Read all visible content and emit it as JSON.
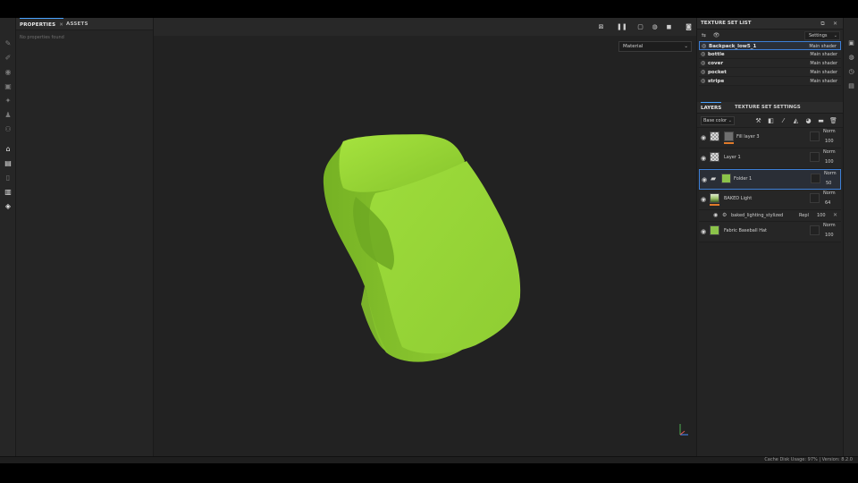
{
  "left_panel": {
    "tabs": [
      {
        "label": "PROPERTIES",
        "selected": true
      },
      {
        "label": "ASSETS",
        "selected": false
      }
    ],
    "empty_message": "No properties found"
  },
  "toolbar": {
    "tools": [
      "paint-brush-icon",
      "eraser-icon",
      "projection-icon",
      "geometry-mask-icon",
      "smudge-icon",
      "clone-icon",
      "material-picker-icon",
      "bake-icon",
      "layers-stack-icon",
      "texture-set-icon",
      "export-icon",
      "shelf-icon"
    ]
  },
  "viewport": {
    "mode_select": "Material",
    "colors": {
      "model": "#a3e040",
      "background": "#222222"
    }
  },
  "texture_set_list": {
    "title": "TEXTURE SET LIST",
    "settings_label": "Settings",
    "sets": [
      {
        "name": "Backpack_low5_1",
        "shader": "Main shader",
        "selected": true
      },
      {
        "name": "bottle",
        "shader": "Main shader",
        "selected": false
      },
      {
        "name": "cover",
        "shader": "Main shader",
        "selected": false
      },
      {
        "name": "pocket",
        "shader": "Main shader",
        "selected": false
      },
      {
        "name": "stripe",
        "shader": "Main shader",
        "selected": false
      }
    ]
  },
  "layers_panel": {
    "tabs": [
      {
        "label": "LAYERS",
        "selected": true
      },
      {
        "label": "TEXTURE SET SETTINGS",
        "selected": false
      }
    ],
    "channel": "Base color",
    "layers": [
      {
        "name": "Fill layer 3",
        "blend": "Norm",
        "opacity": "100",
        "thumb": "checker",
        "color": "gray",
        "bar": "#e07a2a"
      },
      {
        "name": "Layer 1",
        "blend": "Norm",
        "opacity": "100",
        "thumb": "checker",
        "color": "",
        "bar": ""
      },
      {
        "name": "Folder 1",
        "blend": "Norm",
        "opacity": "50",
        "thumb": "folder",
        "color": "green",
        "bar": "",
        "selected": true
      },
      {
        "name": "BAKED Light",
        "blend": "Norm",
        "opacity": "64",
        "thumb": "image",
        "color": "",
        "bar": "#e07a2a"
      },
      {
        "name": "Fabric Baseball Hat",
        "blend": "Norm",
        "opacity": "100",
        "thumb": "green",
        "color": "",
        "bar": ""
      }
    ],
    "effect": {
      "name": "baked_lighting_stylized",
      "blend": "Repl",
      "opacity": "100"
    }
  },
  "status": {
    "text": "Cache Disk Usage:  97%  |  Version: 8.2.0"
  }
}
